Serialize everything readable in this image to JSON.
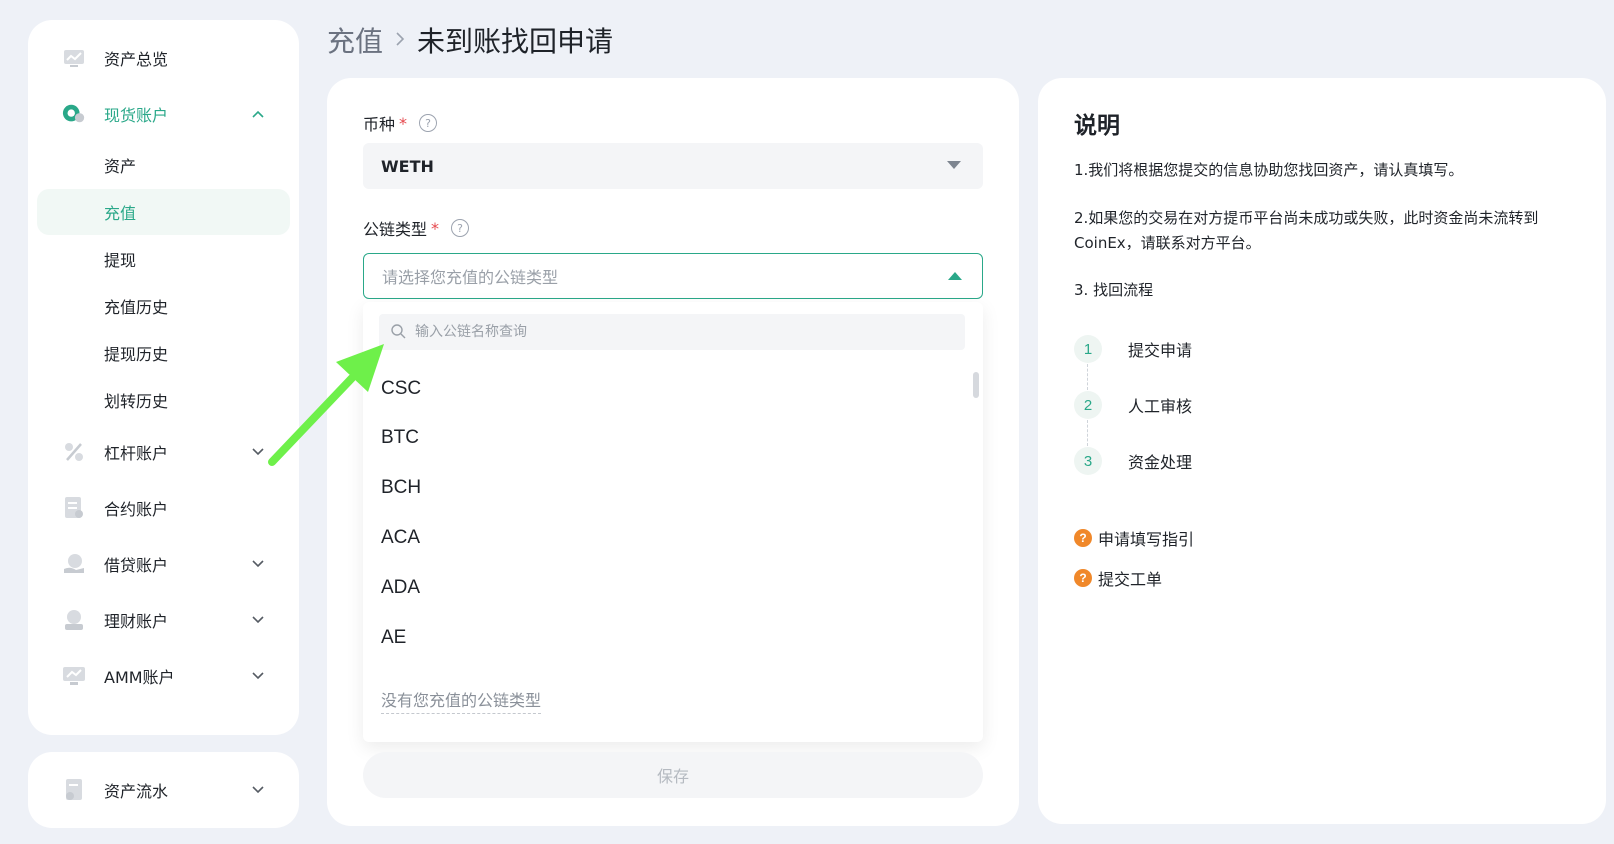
{
  "sidebar": {
    "items": [
      {
        "label": "资产总览",
        "icon": "chart-board-icon",
        "expandable": false
      },
      {
        "label": "现货账户",
        "icon": "spot-coin-icon",
        "expandable": true,
        "expanded": true,
        "active": true,
        "children": [
          "资产",
          "充值",
          "提现",
          "充值历史",
          "提现历史",
          "划转历史"
        ]
      },
      {
        "label": "杠杆账户",
        "icon": "percent-icon",
        "expandable": true
      },
      {
        "label": "合约账户",
        "icon": "contract-doc-icon",
        "expandable": false
      },
      {
        "label": "借贷账户",
        "icon": "loan-hand-icon",
        "expandable": true
      },
      {
        "label": "理财账户",
        "icon": "finance-icon",
        "expandable": true
      },
      {
        "label": "AMM账户",
        "icon": "amm-monitor-icon",
        "expandable": true
      }
    ],
    "active_child": "充值",
    "bottom": {
      "label": "资产流水",
      "icon": "ledger-icon"
    }
  },
  "breadcrumb": {
    "parent": "充值",
    "current": "未到账找回申请"
  },
  "form": {
    "coin_label": "币种",
    "coin_value": "WETH",
    "chain_label": "公链类型",
    "chain_placeholder": "请选择您充值的公链类型",
    "dropdown": {
      "search_placeholder": "输入公链名称查询",
      "options": [
        "CSC",
        "BTC",
        "BCH",
        "ACA",
        "ADA",
        "AE"
      ],
      "footer_link": "没有您充值的公链类型"
    },
    "save_label": "保存"
  },
  "info": {
    "title": "说明",
    "p1": "1.我们将根据您提交的信息协助您找回资产，请认真填写。",
    "p2": "2.如果您的交易在对方提币平台尚未成功或失败，此时资金尚未流转到CoinEx，请联系对方平台。",
    "p3": "3. 找回流程",
    "steps": [
      {
        "num": "1",
        "label": "提交申请"
      },
      {
        "num": "2",
        "label": "人工审核"
      },
      {
        "num": "3",
        "label": "资金处理"
      }
    ],
    "links": [
      {
        "label": "申请填写指引"
      },
      {
        "label": "提交工单"
      }
    ]
  },
  "colors": {
    "accent": "#2aa889",
    "required": "#e5484d",
    "help_badge": "#f0882a",
    "annotation_arrow": "#6ef04a"
  }
}
